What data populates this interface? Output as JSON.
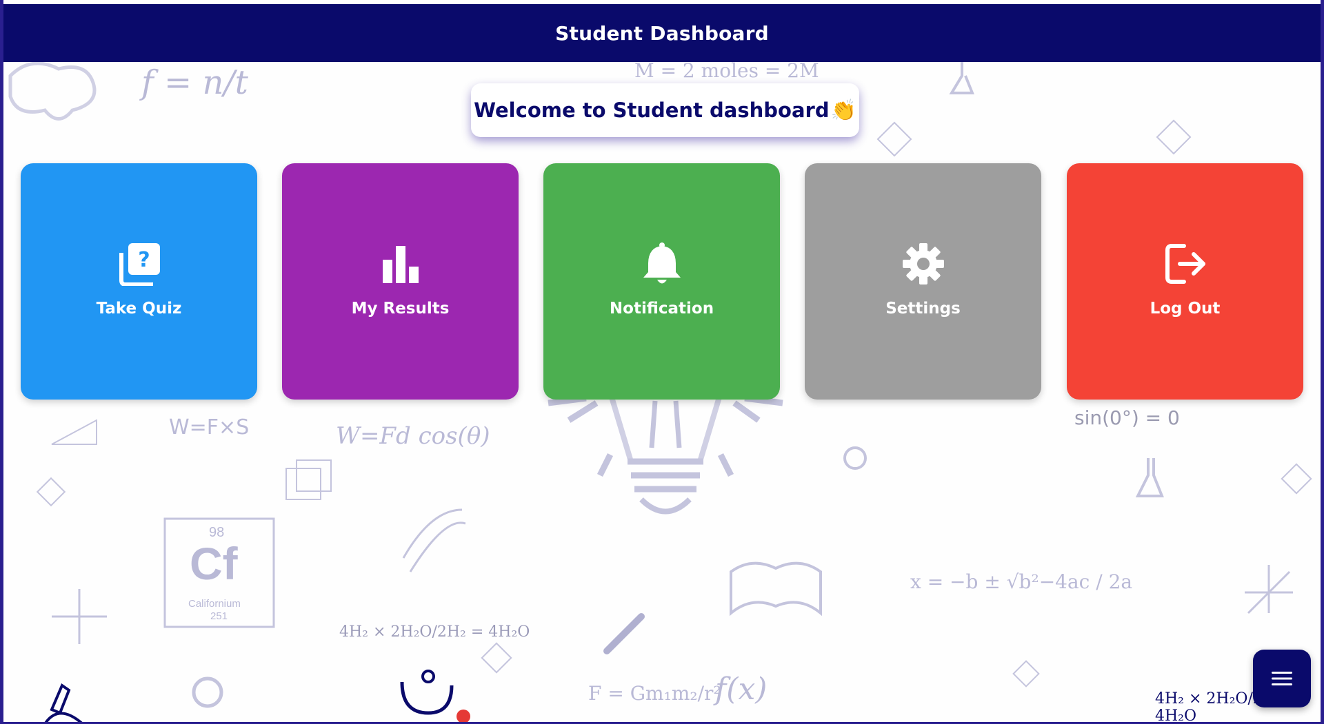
{
  "header": {
    "title": "Student Dashboard"
  },
  "welcome": {
    "text": "Welcome to Student dashboard",
    "emoji": "👏"
  },
  "tiles": [
    {
      "label": "Take Quiz",
      "icon": "quiz-icon",
      "color": "#2196f3"
    },
    {
      "label": "My Results",
      "icon": "bar-chart-icon",
      "color": "#9c27b0"
    },
    {
      "label": "Notification",
      "icon": "bell-icon",
      "color": "#4caf50"
    },
    {
      "label": "Settings",
      "icon": "gear-icon",
      "color": "#9e9e9e"
    },
    {
      "label": "Log Out",
      "icon": "logout-icon",
      "color": "#f44336"
    }
  ],
  "fab": {
    "icon": "menu-icon"
  },
  "background": {
    "formulas": [
      "f = n/t",
      "M = 2 moles = 2M",
      "W=F×S",
      "W=Fd cos(θ)",
      "sin(0°) = 0",
      "x = −b ± √b²−4ac / 2a",
      "4H₂ × 2H₂O/2H₂ = 4H₂O",
      "F = Gm₁m₂/r²",
      "f(x)"
    ],
    "element": {
      "number": "98",
      "symbol": "Cf",
      "name": "Californium",
      "mass": "251"
    }
  },
  "colors": {
    "header": "#0a0a6b",
    "accent": "#2a1f8f"
  }
}
